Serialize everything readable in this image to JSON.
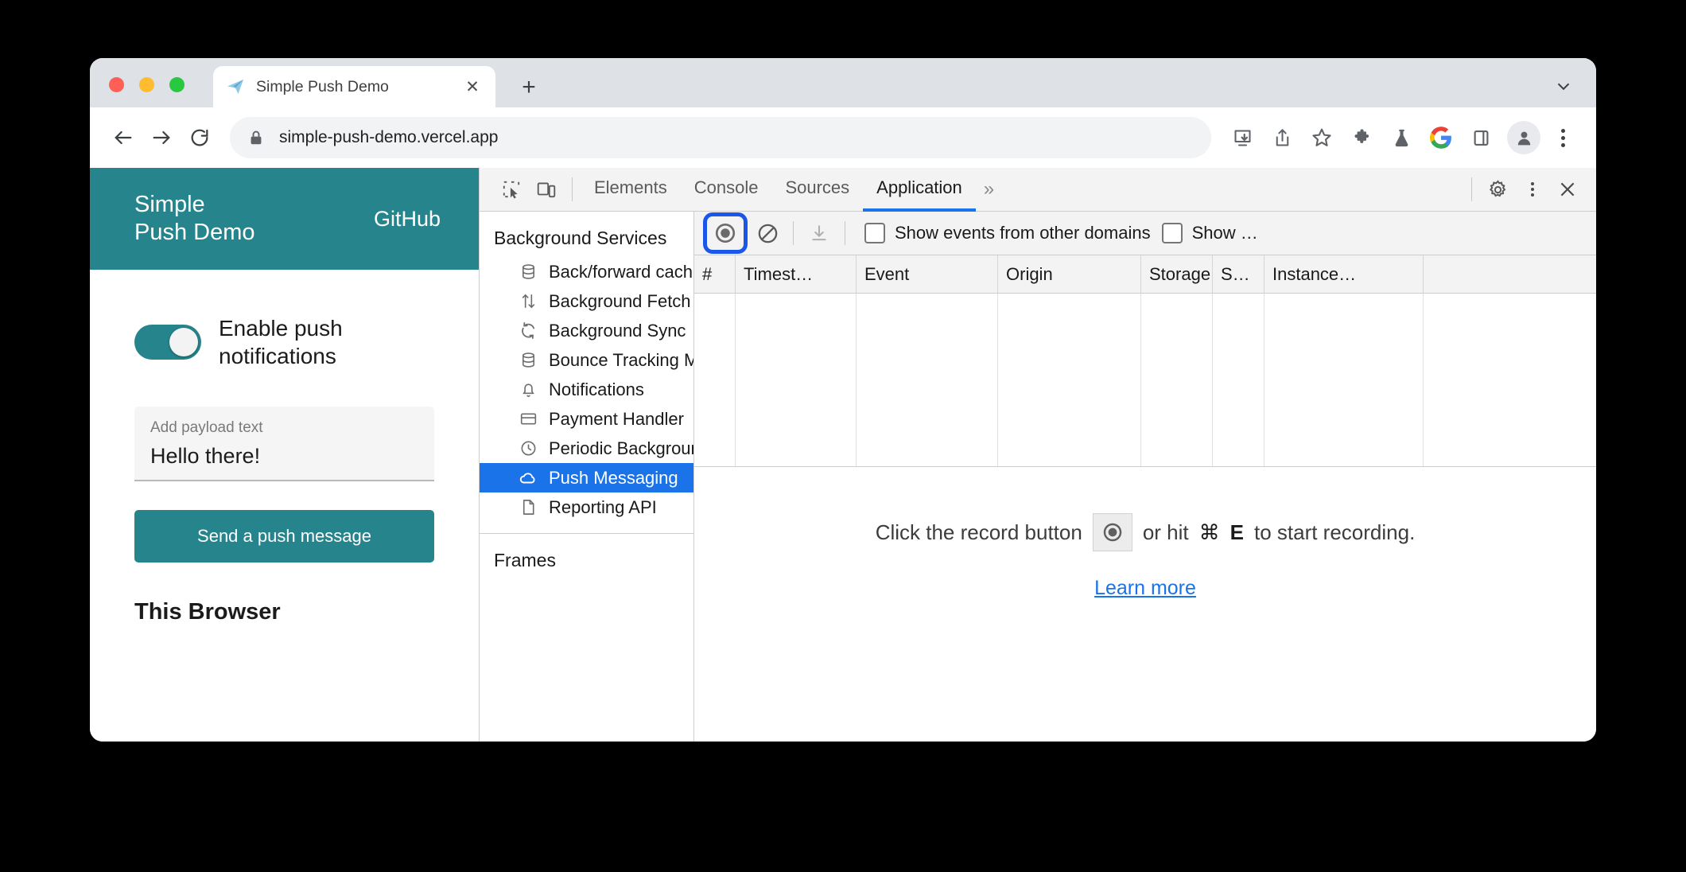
{
  "browser": {
    "traffic_lights": [
      "close",
      "minimize",
      "zoom"
    ],
    "tab": {
      "title": "Simple Push Demo",
      "favicon": "paper-plane-icon",
      "close_label": "✕"
    },
    "new_tab_label": "+",
    "tabstrip_expand": "chevron-down-icon",
    "nav": {
      "back": "back-arrow-icon",
      "forward": "forward-arrow-icon",
      "reload": "reload-icon"
    },
    "omnibox": {
      "lock": "lock-icon",
      "url": "simple-push-demo.vercel.app"
    },
    "actions": [
      "install-icon",
      "share-icon",
      "bookmark-star-icon",
      "extensions-puzzle-icon",
      "labs-flask-icon",
      "google-g-icon",
      "side-panel-icon"
    ],
    "avatar": "profile-avatar-icon",
    "menu": "three-dot-menu-icon"
  },
  "page": {
    "header": {
      "title_line1": "Simple",
      "title_line2": "Push Demo",
      "github_link": "GitHub",
      "bg_color": "#26858c"
    },
    "toggle": {
      "label_line1": "Enable push",
      "label_line2": "notifications",
      "state": "on"
    },
    "payload": {
      "placeholder": "Add payload text",
      "value": "Hello there!"
    },
    "send_button": "Send a push message",
    "section_heading": "This Browser"
  },
  "devtools": {
    "toolbar_icons": {
      "inspect": "inspect-element-icon",
      "device": "device-toolbar-icon",
      "settings": "gear-icon",
      "menu": "three-dot-menu-icon",
      "close": "close-icon"
    },
    "tabs": [
      {
        "label": "Elements",
        "active": false
      },
      {
        "label": "Console",
        "active": false
      },
      {
        "label": "Sources",
        "active": false
      },
      {
        "label": "Application",
        "active": true
      }
    ],
    "more_tabs": "»",
    "sidebar": {
      "group_title": "Background Services",
      "items": [
        {
          "label": "Back/forward cache",
          "icon": "database-icon",
          "selected": false
        },
        {
          "label": "Background Fetch",
          "icon": "updown-arrows-icon",
          "selected": false
        },
        {
          "label": "Background Sync",
          "icon": "sync-icon",
          "selected": false
        },
        {
          "label": "Bounce Tracking Mitigations",
          "icon": "database-icon",
          "selected": false
        },
        {
          "label": "Notifications",
          "icon": "bell-icon",
          "selected": false
        },
        {
          "label": "Payment Handler",
          "icon": "credit-card-icon",
          "selected": false
        },
        {
          "label": "Periodic Background Sync",
          "icon": "clock-icon",
          "selected": false
        },
        {
          "label": "Push Messaging",
          "icon": "cloud-icon",
          "selected": true
        },
        {
          "label": "Reporting API",
          "icon": "document-icon",
          "selected": false
        }
      ],
      "group_title2": "Frames"
    },
    "actionbar": {
      "record": "record-icon",
      "clear": "clear-circle-slash-icon",
      "save": "download-icon",
      "checkbox1": "Show events from other domains",
      "checkbox2": "Show …",
      "checkbox1_checked": false,
      "checkbox2_checked": false,
      "focus_ring_color": "#1a56e8"
    },
    "table": {
      "columns": [
        "#",
        "Timest…",
        "Event",
        "Origin",
        "Storage …",
        "S…",
        "Instance…"
      ],
      "rows": []
    },
    "empty_state": {
      "text_before": "Click the record button",
      "record_icon": "record-icon",
      "text_middle": "or hit",
      "kbd_cmd": "⌘",
      "kbd_key": "E",
      "text_after": "to start recording.",
      "link": "Learn more"
    }
  }
}
